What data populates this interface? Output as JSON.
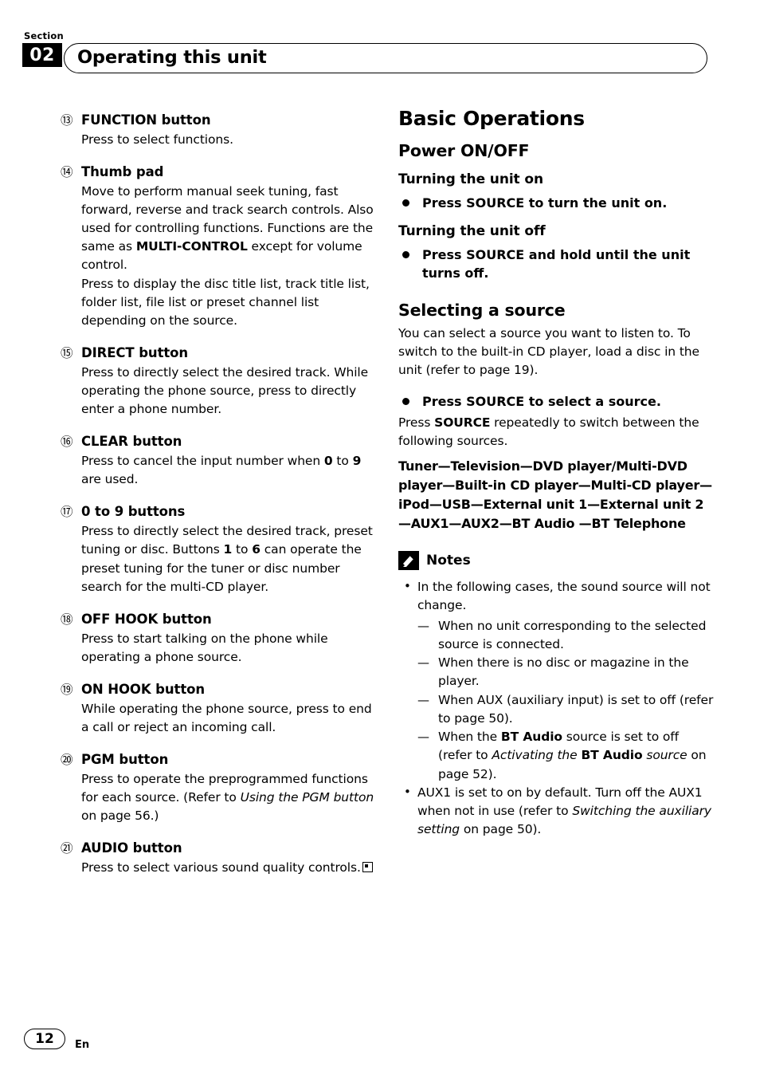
{
  "header": {
    "section_label": "Section",
    "section_number": "02",
    "title": "Operating this unit"
  },
  "left_column": {
    "items": [
      {
        "marker": "⑬",
        "title": "FUNCTION button",
        "body": "Press to select functions."
      },
      {
        "marker": "⑭",
        "title": "Thumb pad",
        "body_html": "Move to perform manual seek tuning, fast forward, reverse and track search controls. Also used for controlling functions. Functions are the same as <b>MULTI-CONTROL</b> except for volume control.<br>Press to display the disc title list, track title list, folder list, file list or preset channel list depending on the source."
      },
      {
        "marker": "⑮",
        "title": "DIRECT button",
        "body": "Press to directly select the desired track. While operating the phone source, press to directly enter a phone number."
      },
      {
        "marker": "⑯",
        "title": "CLEAR button",
        "body_html": "Press to cancel the input number when <b>0</b> to <b>9</b> are used."
      },
      {
        "marker": "⑰",
        "title": "0 to 9 buttons",
        "body_html": "Press to directly select the desired track, preset tuning or disc. Buttons <b>1</b> to <b>6</b> can operate the preset tuning for the tuner or disc number search for the multi-CD player."
      },
      {
        "marker": "⑱",
        "title": "OFF HOOK button",
        "body": "Press to start talking on the phone while operating a phone source."
      },
      {
        "marker": "⑲",
        "title": "ON HOOK button",
        "body": "While operating the phone source, press to end a call or reject an incoming call."
      },
      {
        "marker": "⑳",
        "title": "PGM button",
        "body_html": "Press to operate the preprogrammed functions for each source. (Refer to <i>Using the PGM button</i> on page 56.)"
      },
      {
        "marker": "㉑",
        "title": "AUDIO button",
        "body_html": "Press to select various sound quality controls.<span class=\"endmark\"></span>"
      }
    ]
  },
  "right_column": {
    "basic_operations_title": "Basic Operations",
    "power_onoff_title": "Power ON/OFF",
    "turning_on_title": "Turning the unit on",
    "turning_on_bullet": "Press SOURCE to turn the unit on.",
    "turning_off_title": "Turning the unit off",
    "turning_off_bullet": "Press SOURCE and hold until the unit turns off.",
    "selecting_source_title": "Selecting a source",
    "selecting_source_para": "You can select a source you want to listen to. To switch to the built-in CD player, load a disc in the unit (refer to page 19).",
    "select_source_bullet": "Press SOURCE to select a source.",
    "press_source_para_html": "Press <b>SOURCE</b> repeatedly to switch between the following sources.",
    "sources_html": "Tuner—Television—DVD player/Multi-DVD player—Built-in CD player—Multi-CD player—iPod—USB—External unit 1—External unit 2—AUX1—AUX2—BT Audio —BT Telephone",
    "notes_title": "Notes",
    "notes": [
      {
        "text": "In the following cases, the sound source will not change.",
        "subs": [
          "When no unit corresponding to the selected source is connected.",
          "When there is no disc or magazine in the player.",
          "When AUX (auxiliary input) is set to off (refer to page 50).",
          "When the <b>BT Audio</b> source is set to off (refer to <i>Activating the</i> <b>BT Audio</b> <i>source</i> on page 52)."
        ]
      },
      {
        "text_html": "AUX1 is set to on by default. Turn off the AUX1 when not in use (refer to <i>Switching the auxiliary setting</i> on page 50).",
        "subs": []
      }
    ]
  },
  "footer": {
    "page_number": "12",
    "language": "En"
  }
}
